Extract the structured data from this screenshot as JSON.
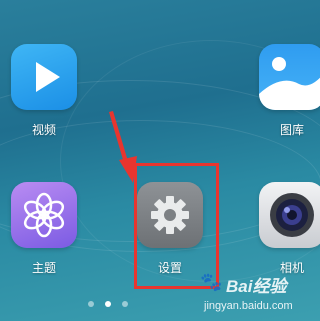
{
  "apps": {
    "video": {
      "label": "视频"
    },
    "gallery": {
      "label": "图库"
    },
    "theme": {
      "label": "主题"
    },
    "settings": {
      "label": "设置"
    },
    "camera": {
      "label": "相机"
    }
  },
  "pager": {
    "current_page": 2,
    "total_pages": 3
  },
  "annotation": {
    "color": "#e8352f"
  },
  "watermark": {
    "brand_ai": "Bai",
    "brand_cn": "经验",
    "url": "jingyan.baidu.com"
  }
}
